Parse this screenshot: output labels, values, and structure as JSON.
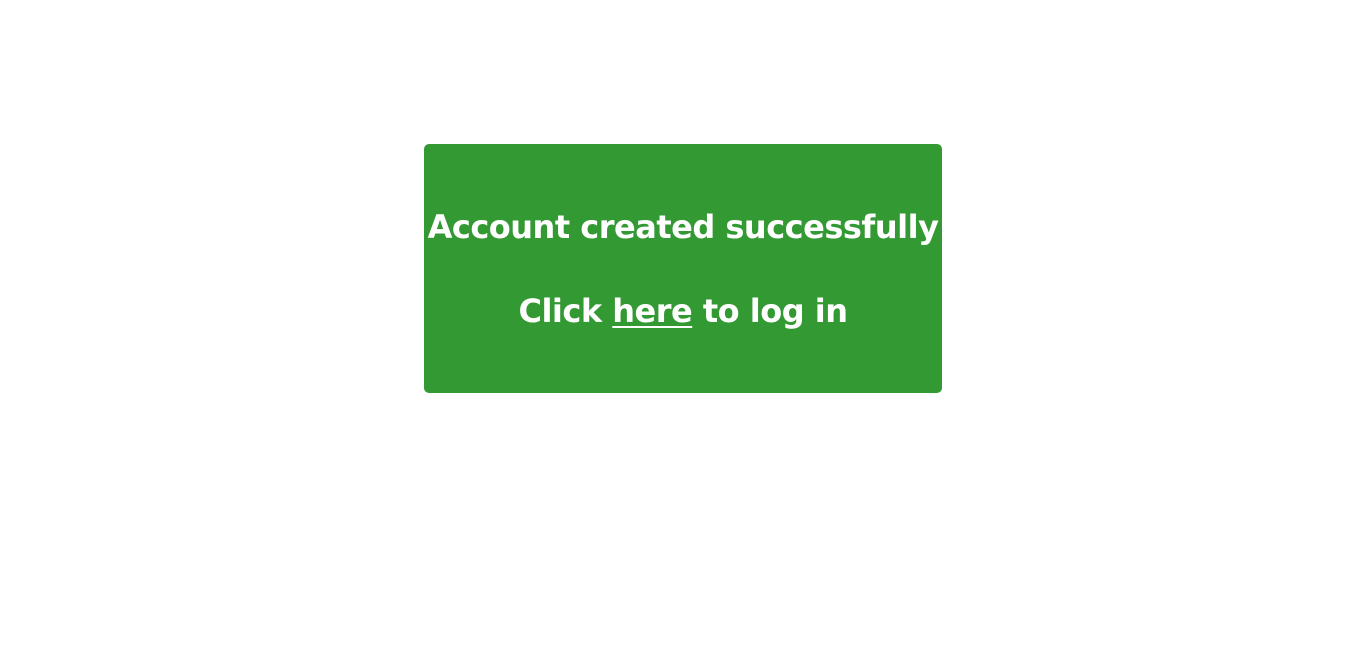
{
  "message": {
    "title": "Account created successfully",
    "login_prefix": "Click ",
    "login_link": "here",
    "login_suffix": " to log in"
  },
  "colors": {
    "card_background": "#339933",
    "text": "#ffffff",
    "page_background": "#ffffff"
  }
}
